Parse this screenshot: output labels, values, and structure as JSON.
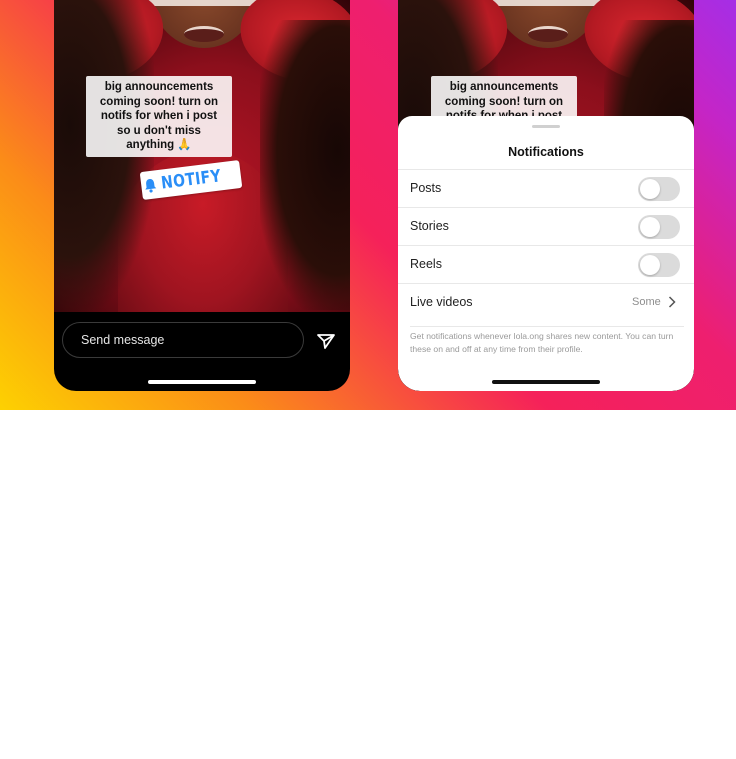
{
  "story": {
    "caption_lines": [
      "big announcements",
      "coming soon! turn on",
      "notifs for when i post",
      "so u don't miss",
      "anything 🙏"
    ],
    "caption_lines_partial": [
      "big announcements",
      "coming soon! turn on",
      "notifs for when i post"
    ],
    "notify_label": "NOTIFY",
    "notify_icon": "bell-icon",
    "message_placeholder": "Send message",
    "send_icon": "send-icon"
  },
  "sheet": {
    "title": "Notifications",
    "rows": [
      {
        "label": "Posts",
        "type": "toggle",
        "on": false
      },
      {
        "label": "Stories",
        "type": "toggle",
        "on": false
      },
      {
        "label": "Reels",
        "type": "toggle",
        "on": false
      },
      {
        "label": "Live videos",
        "type": "select",
        "value": "Some"
      }
    ],
    "footnote": "Get notifications whenever lola.ong shares new content. You can turn these on and off at any time from their profile."
  },
  "colors": {
    "accent_blue": "#2a8ef7",
    "toggle_off": "#dbdbdb"
  }
}
